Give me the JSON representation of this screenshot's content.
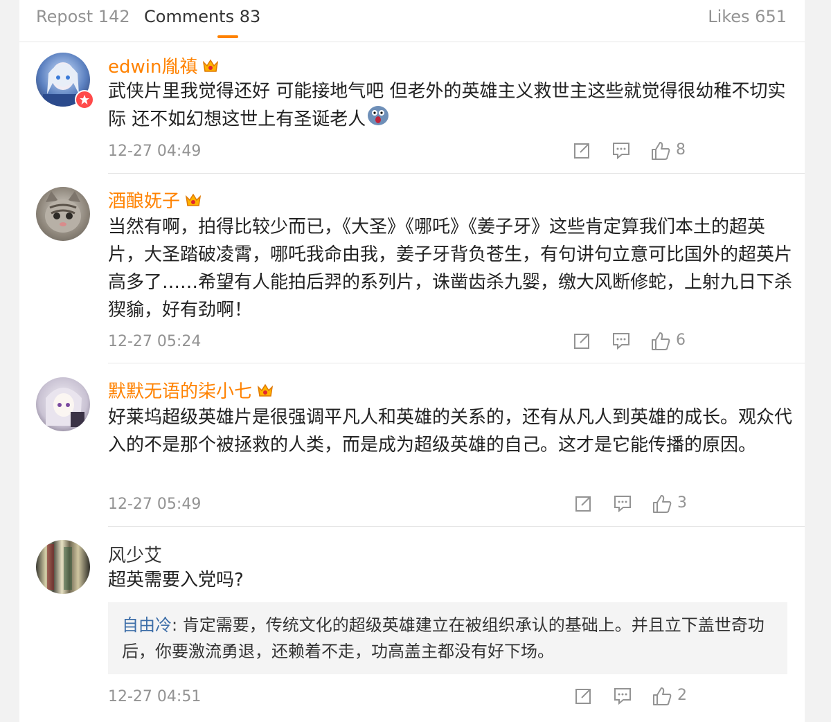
{
  "tabs": {
    "repost": "Repost 142",
    "comments": "Comments 83",
    "likes": "Likes 651"
  },
  "colors": {
    "accent": "#ff8200",
    "vip_name": "#ff8200",
    "reply_author": "#3d6ea8"
  },
  "comments": [
    {
      "username": "edwin胤禛",
      "vip": true,
      "verified": true,
      "text": "武侠片里我觉得还好 可能接地气吧 但老外的英雄主义救世主这些就觉得很幼稚不切实际 还不如幻想这世上有圣诞老人",
      "emoji": "scared-face-emoji",
      "time": "12-27 04:49",
      "likes": "8"
    },
    {
      "username": "酒酿妩子",
      "vip": true,
      "verified": false,
      "text": "当然有啊，拍得比较少而已，《大圣》《哪吒》《姜子牙》这些肯定算我们本土的超英片，大圣踏破凌霄，哪吒我命由我，姜子牙背负苍生，有句讲句立意可比国外的超英片高多了……希望有人能拍后羿的系列片，诛凿齿杀九婴，缴大风断修蛇，上射九日下杀猰貐，好有劲啊！",
      "time": "12-27 05:24",
      "likes": "6"
    },
    {
      "username": "默默无语的柒小七",
      "vip": true,
      "verified": false,
      "text": "好莱坞超级英雄片是很强调平凡人和英雄的关系的，还有从凡人到英雄的成长。观众代入的不是那个被拯救的人类，而是成为超级英雄的自己。这才是它能传播的原因。",
      "time": "12-27 05:49",
      "likes": "3"
    },
    {
      "username": "风少艾",
      "vip": false,
      "verified": false,
      "text": "超英需要入党吗?",
      "reply": {
        "author": "自由冷",
        "text": ": 肯定需要，传统文化的超级英雄建立在被组织承认的基础上。并且立下盖世奇功后，你要激流勇退，还赖着不走，功高盖主都没有好下场。"
      },
      "time": "12-27 04:51",
      "likes": "2"
    }
  ],
  "icons": [
    "repost-icon",
    "comment-icon",
    "thumbs-up-icon",
    "crown-icon",
    "verified-badge-icon"
  ]
}
